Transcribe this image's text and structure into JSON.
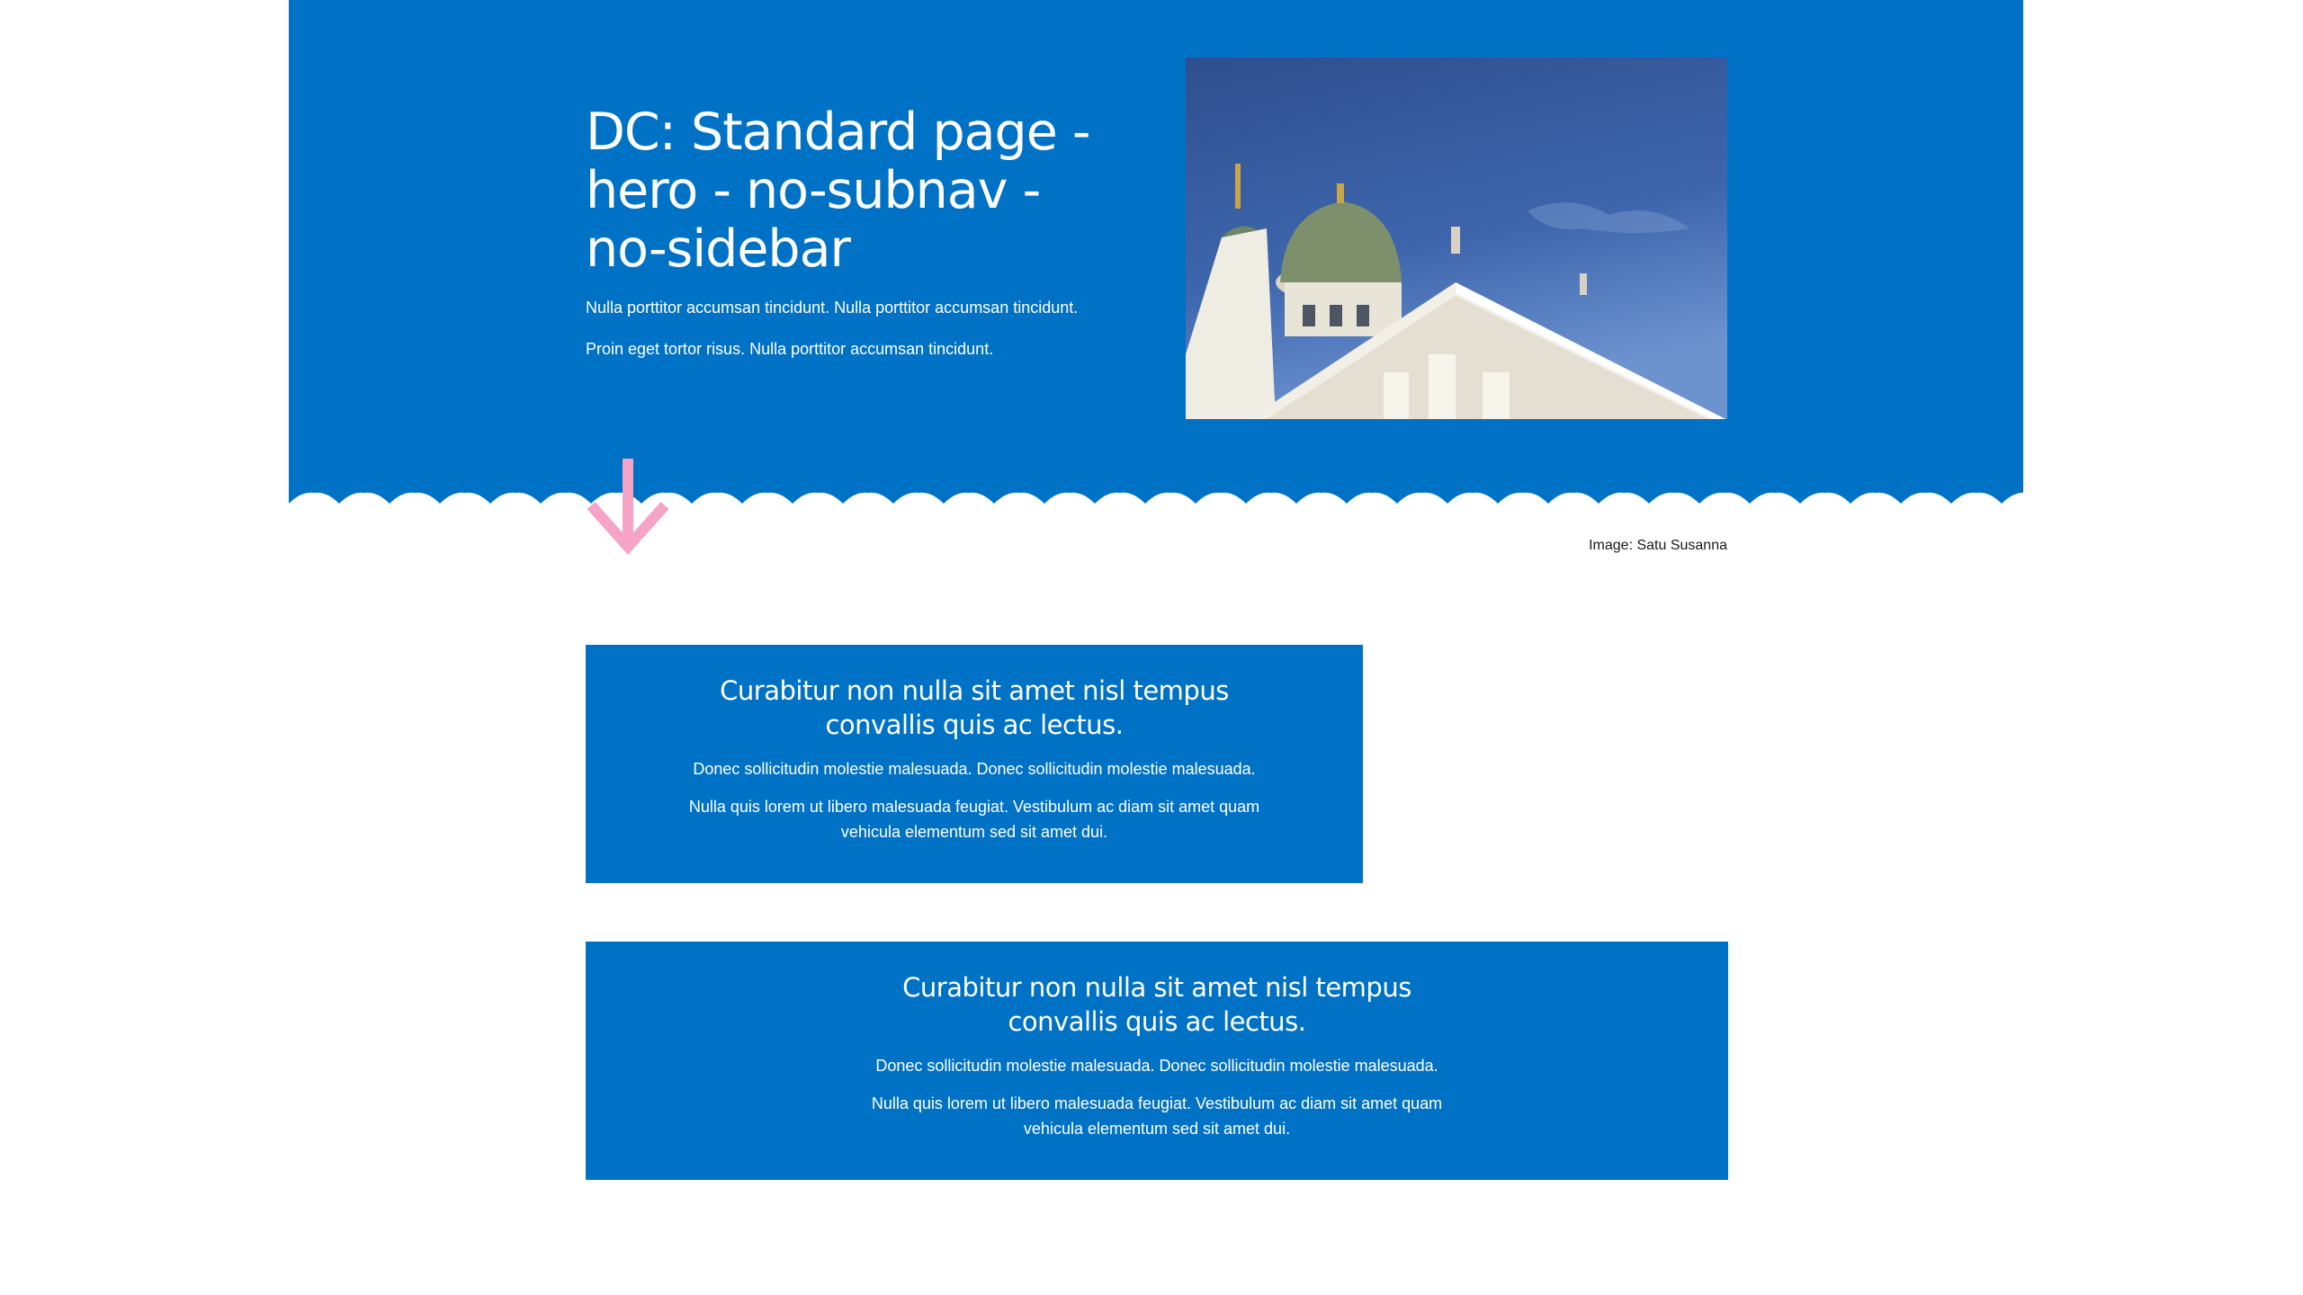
{
  "hero": {
    "title": "DC: Standard page - hero - no-subnav - no-sidebar",
    "paragraph_1": "Nulla porttitor accumsan tincidunt. Nulla porttitor accumsan tincidunt.",
    "paragraph_2": "Proin eget tortor risus. Nulla porttitor accumsan tincidunt.",
    "image_subject": "Helsinki Cathedral against blue sky",
    "image_caption": "Image: Satu Susanna",
    "arrow_icon": "arrow-down-icon"
  },
  "content_blocks": [
    {
      "title": "Curabitur non nulla sit amet nisl tempus convallis quis ac lectus.",
      "paragraph_1": "Donec sollicitudin molestie malesuada. Donec sollicitudin molestie malesuada.",
      "paragraph_2": "Nulla quis lorem ut libero malesuada feugiat. Vestibulum ac diam sit amet quam vehicula elementum sed sit amet dui."
    },
    {
      "title": "Curabitur non nulla sit amet nisl tempus convallis quis ac lectus.",
      "paragraph_1": "Donec sollicitudin molestie malesuada. Donec sollicitudin molestie malesuada.",
      "paragraph_2": "Nulla quis lorem ut libero malesuada feugiat. Vestibulum ac diam sit amet quam vehicula elementum sed sit amet dui."
    }
  ],
  "colors": {
    "brand_blue": "#0072c6",
    "arrow_pink": "#f5a3c7",
    "background": "#ffffff",
    "text_on_blue": "#ffffff"
  }
}
